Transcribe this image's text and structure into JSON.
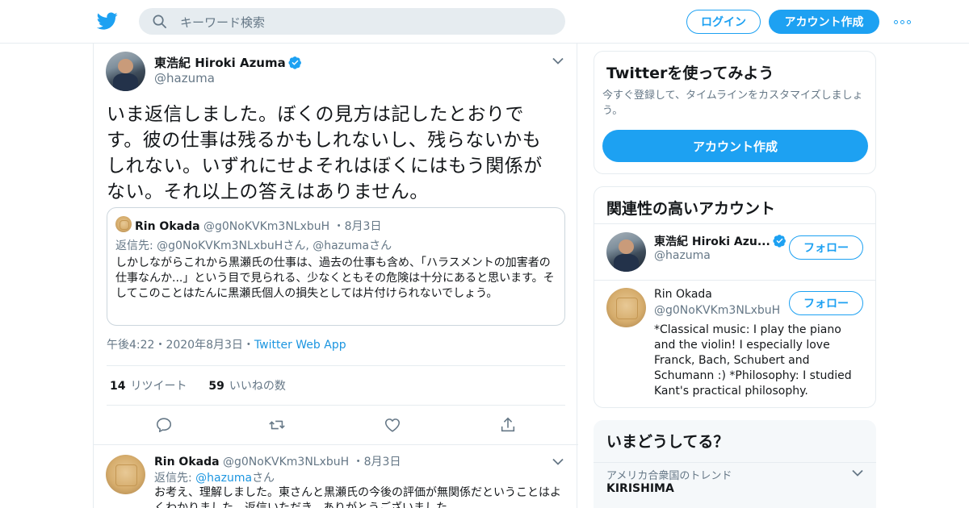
{
  "nav": {
    "search_placeholder": "キーワード検索",
    "login_label": "ログイン",
    "signup_label": "アカウント作成"
  },
  "tweet": {
    "author_name": "東浩紀 Hiroki Azuma",
    "author_handle": "@hazuma",
    "text": "いま返信しました。ぼくの見方は記したとおりです。彼の仕事は残るかもしれないし、残らないかもしれない。いずれにせよそれはぼくにはもう関係がない。それ以上の答えはありません。",
    "quoted": {
      "name": "Rin Okada",
      "handle": "@g0NoKVKm3NLxbuH",
      "date": "8月3日",
      "reply_prefix": "返信先:",
      "reply_to": "@g0NoKVKm3NLxbuHさん, @hazumaさん",
      "text": "しかしながらこれから黒瀬氏の仕事は、過去の仕事も含め、「ハラスメントの加害者の仕事なんか...」という目で見られる、少なくともその危険は十分にあると思います。そしてこのことはたんに黒瀬氏個人の損失としては片付けられないでしょう。"
    },
    "time": "午後4:22",
    "date": "2020年8月3日",
    "source": "Twitter Web App",
    "retweet_count": "14",
    "retweet_label": "リツイート",
    "like_count": "59",
    "like_label": "いいねの数"
  },
  "reply": {
    "name": "Rin Okada",
    "handle": "@g0NoKVKm3NLxbuH",
    "date": "8月3日",
    "reply_prefix": "返信先:",
    "reply_to_handle": "@hazuma",
    "reply_to_suffix": "さん",
    "text": "お考え、理解しました。東さんと黒瀬氏の今後の評価が無関係だということはよくわかりました。返信いただき、ありがとうございました。"
  },
  "sidebar": {
    "signup": {
      "title": "Twitterを使ってみよう",
      "subtitle": "今すぐ登録して、タイムラインをカスタマイズしましょう。",
      "button": "アカウント作成"
    },
    "related": {
      "title": "関連性の高いアカウント",
      "accounts": [
        {
          "name": "東浩紀 Hiroki Azu...",
          "handle": "@hazuma",
          "follow": "フォロー"
        },
        {
          "name": "Rin Okada",
          "handle": "@g0NoKVKm3NLxbuH",
          "follow": "フォロー",
          "bio": "*Classical music: I play the piano and the violin! I especially love Franck, Bach, Schubert and Schumann :) *Philosophy: I studied Kant's practical philosophy."
        }
      ]
    },
    "trends": {
      "title": "いまどうしてる？",
      "items": [
        {
          "context": "アメリカ合衆国のトレンド",
          "name": "KIRISHIMA"
        }
      ]
    }
  },
  "colors": {
    "brand": "#1da1f2",
    "link": "#1b95e0",
    "muted": "#657786",
    "border": "#e6ecf0"
  },
  "icons": [
    "twitter-logo-icon",
    "search-icon",
    "more-icon",
    "verified-icon",
    "chevron-down-icon",
    "reply-icon",
    "retweet-icon",
    "like-icon",
    "share-icon"
  ]
}
